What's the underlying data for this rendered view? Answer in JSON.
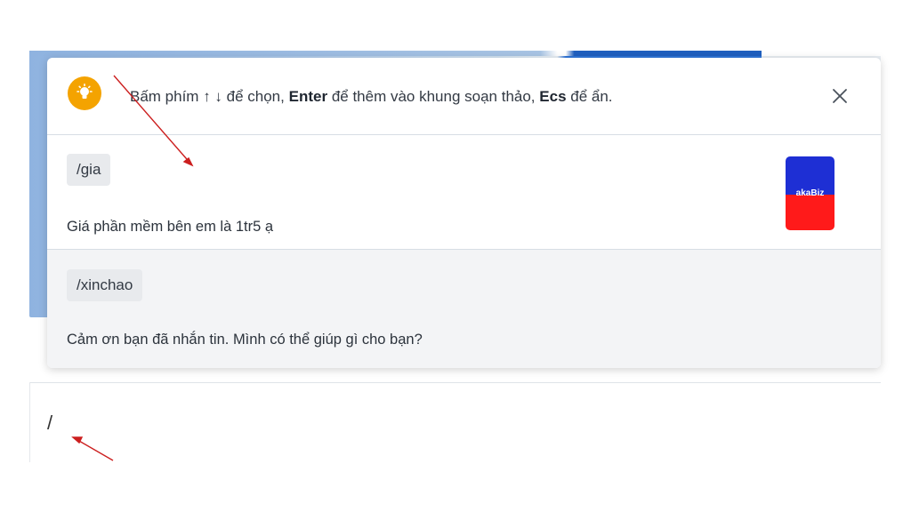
{
  "hint": {
    "prefix": "Bấm phím ↑ ↓ để chọn,",
    "key_enter": "Enter",
    "middle": "để thêm vào khung soạn thảo,",
    "key_esc": "Ecs",
    "suffix": "để ẩn.",
    "icon": "lightbulb-icon",
    "close_icon": "close-icon"
  },
  "quick_replies": [
    {
      "shortcut": "/gia",
      "text": "Giá phần mềm bên em là 1tr5 ạ",
      "thumbnail_label": "akaBiz"
    },
    {
      "shortcut": "/xinchao",
      "text": "Cảm ơn bạn đã nhắn tin. Mình có thể giúp gì cho bạn?"
    }
  ],
  "composer": {
    "value": "/"
  },
  "colors": {
    "bulb": "#f4a300",
    "selected_row": "#f3f4f6",
    "annotation_arrow": "#cc1f1f"
  }
}
